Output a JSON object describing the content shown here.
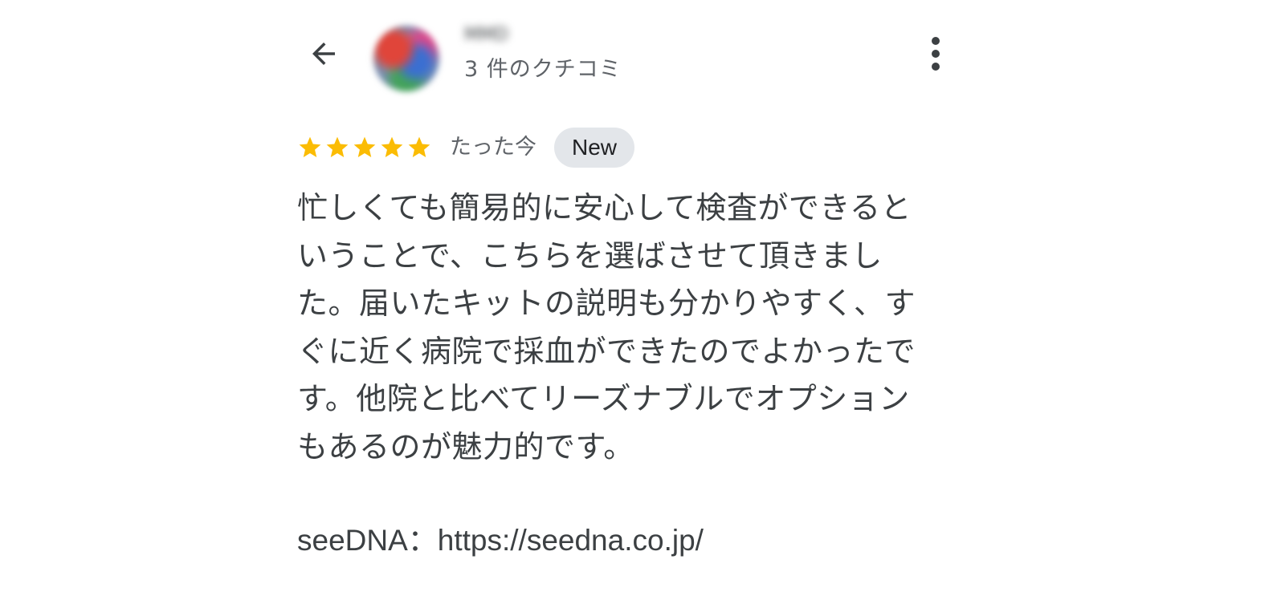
{
  "header": {
    "reviewer_name": "MMD",
    "review_count": "3 件のクチコミ",
    "back_icon": "arrow-left-icon",
    "more_icon": "more-vert-icon"
  },
  "review": {
    "rating": 5,
    "max_rating": 5,
    "star_color": "#fbbc04",
    "time": "たった今",
    "badge": "New",
    "body_lines": [
      "忙しくても簡易的に安心して検査ができると",
      "いうことで、こちらを選ばさせて頂きまし",
      "た。届いたキットの説明も分かりやすく、す",
      "ぐに近く病院で採血ができたのでよかったで",
      "す。他院と比べてリーズナブルでオプション",
      "もあるのが魅力的です。"
    ],
    "link_text": "seeDNA：https://seedna.co.jp/"
  }
}
